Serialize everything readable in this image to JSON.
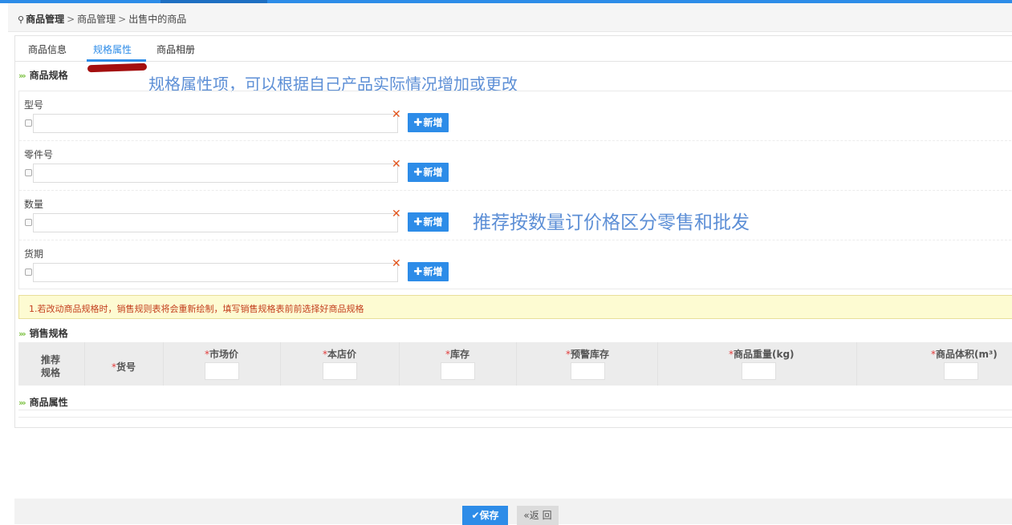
{
  "breadcrumb": {
    "pin_icon": "map-pin-icon",
    "root": "商品管理",
    "sep": ">",
    "level2": "商品管理",
    "current": "出售中的商品"
  },
  "tabs": [
    {
      "label": "商品信息",
      "active": false
    },
    {
      "label": "规格属性",
      "active": true
    },
    {
      "label": "商品相册",
      "active": false
    }
  ],
  "annotations": {
    "spec_note": "规格属性项，可以根据自己产品实际情况增加或更改",
    "qty_note": "推荐按数量订价格区分零售和批发"
  },
  "spec_section": {
    "title": "商品规格",
    "add_label": "新增",
    "groups": [
      {
        "label": "型号",
        "value": ""
      },
      {
        "label": "零件号",
        "value": ""
      },
      {
        "label": "数量",
        "value": ""
      },
      {
        "label": "货期",
        "value": ""
      }
    ]
  },
  "notice": "1.若改动商品规格时，销售规则表将会重新绘制，填写销售规格表前前选择好商品规格",
  "sales_section": {
    "title": "销售规格",
    "headers": [
      {
        "label": "推荐\n规格",
        "required": false
      },
      {
        "label": "货号",
        "required": true
      },
      {
        "label": "市场价",
        "required": true
      },
      {
        "label": "本店价",
        "required": true
      },
      {
        "label": "库存",
        "required": true
      },
      {
        "label": "预警库存",
        "required": true
      },
      {
        "label": "商品重量(kg)",
        "required": true
      },
      {
        "label": "商品体积(m³)",
        "required": true
      }
    ],
    "required_mark": "*"
  },
  "attr_section": {
    "title": "商品属性"
  },
  "footer": {
    "save_label": "保存",
    "save_icon": "check-icon",
    "back_label": "«返 回"
  },
  "colors": {
    "primary": "#2d8ce8",
    "accent_green": "#7cc142",
    "notice_bg": "#fdfbd2",
    "notice_text": "#c33d1c",
    "annotation": "#5d8fd6",
    "remove_x": "#e2541b"
  }
}
